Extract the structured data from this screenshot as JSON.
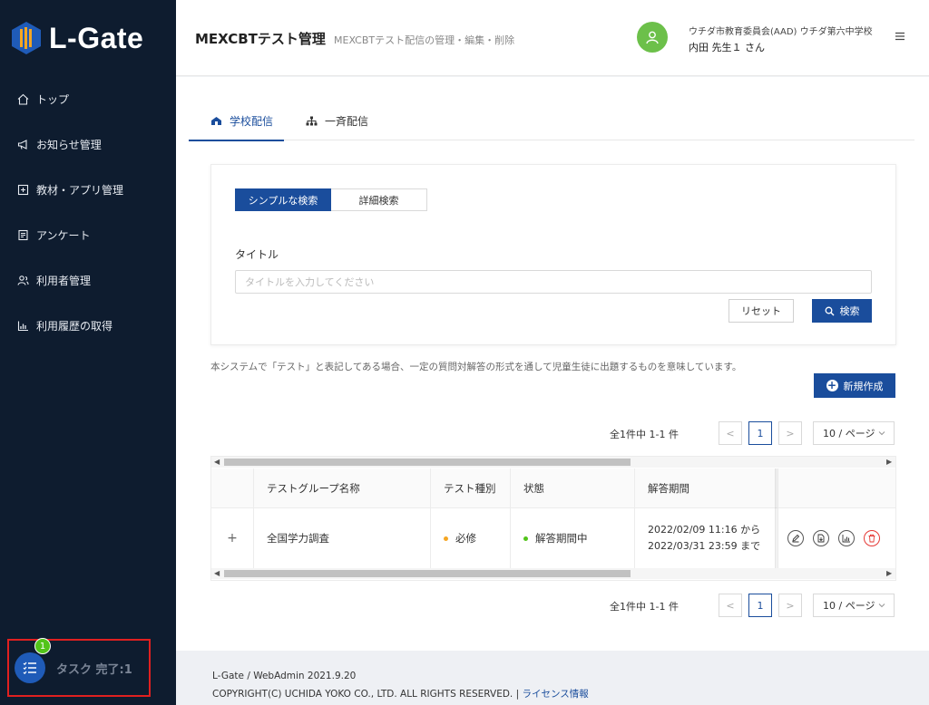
{
  "brand": {
    "name": "L-Gate"
  },
  "sidebar": {
    "items": [
      {
        "label": "トップ",
        "icon": "home-icon"
      },
      {
        "label": "お知らせ管理",
        "icon": "megaphone-icon"
      },
      {
        "label": "教材・アプリ管理",
        "icon": "plus-square-icon"
      },
      {
        "label": "アンケート",
        "icon": "document-icon"
      },
      {
        "label": "利用者管理",
        "icon": "users-icon"
      },
      {
        "label": "利用履歴の取得",
        "icon": "bar-chart-icon"
      }
    ],
    "task": {
      "badge": "1",
      "label": "タスク 完了:1"
    }
  },
  "header": {
    "title": "MEXCBTテスト管理",
    "subtitle": "MEXCBTテスト配信の管理・編集・削除",
    "user_org": "ウチダ市教育委員会(AAD)  ウチダ第六中学校",
    "user_name": "内田 先生１ さん"
  },
  "tabs": [
    {
      "label": "学校配信",
      "active": true
    },
    {
      "label": "一斉配信",
      "active": false
    }
  ],
  "search": {
    "mode_simple": "シンプルな検索",
    "mode_detail": "詳細検索",
    "title_label": "タイトル",
    "title_placeholder": "タイトルを入力してください",
    "reset_label": "リセット",
    "search_label": "検索"
  },
  "notice": "本システムで「テスト」と表記してある場合、一定の質問対解答の形式を通して児童生徒に出題するものを意味しています。",
  "new_button": "新規作成",
  "pagination": {
    "total": "全1件中 1-1 件",
    "current": "1",
    "prev": "<",
    "next": ">",
    "page_size": "10 / ページ"
  },
  "table": {
    "columns": [
      "テストグループ名称",
      "テスト種別",
      "状態",
      "解答期間"
    ],
    "rows": [
      {
        "expand": "+",
        "name": "全国学力調査",
        "type": "必修",
        "status": "解答期間中",
        "period_from": "2022/02/09 11:16 から",
        "period_to": "2022/03/31 23:59 まで"
      }
    ]
  },
  "colors": {
    "primary": "#1a4d9c",
    "sidebar": "#0e1c2f",
    "type_dot": "#f5a623",
    "status_dot": "#52c41a",
    "avatar": "#6cc04a",
    "danger": "#e53935"
  },
  "footer": {
    "version": "L-Gate / WebAdmin 2021.9.20",
    "copyright": "COPYRIGHT(C) UCHIDA YOKO CO., LTD. ALL RIGHTS RESERVED. | ",
    "license": "ライセンス情報"
  }
}
